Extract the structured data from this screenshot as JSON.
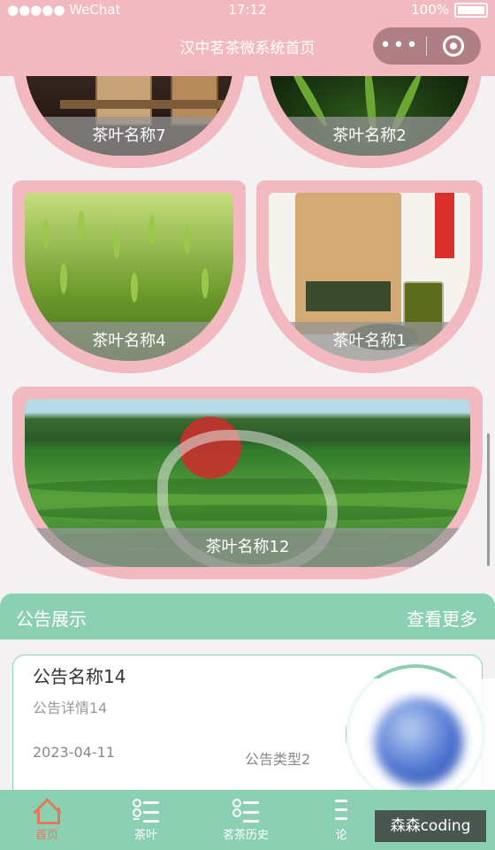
{
  "status_bar": {
    "carrier": "●●●●● WeChat",
    "time": "17:12",
    "battery": "100%"
  },
  "nav": {
    "title": "汉中茗茶微系统首页",
    "menu_dots": "•••"
  },
  "tea_cards": [
    {
      "label": "茶叶名称7"
    },
    {
      "label": "茶叶名称2"
    },
    {
      "label": "茶叶名称4"
    },
    {
      "label": "茶叶名称1"
    },
    {
      "label": "茶叶名称12"
    }
  ],
  "notice": {
    "section_title": "公告展示",
    "more_label": "查看更多",
    "items": [
      {
        "name": "公告名称14",
        "detail": "公告详情14",
        "date": "2023-04-11",
        "type": "公告类型2"
      }
    ]
  },
  "tabbar": {
    "items": [
      {
        "label": "首页",
        "active": true
      },
      {
        "label": "茶叶"
      },
      {
        "label": "茗茶历史"
      },
      {
        "label": "论"
      }
    ]
  },
  "watermark": "森森coding",
  "colors": {
    "header_pink": "#f2b9c0",
    "accent_green": "#8bd0b3",
    "active_tab": "#e07a5f"
  }
}
